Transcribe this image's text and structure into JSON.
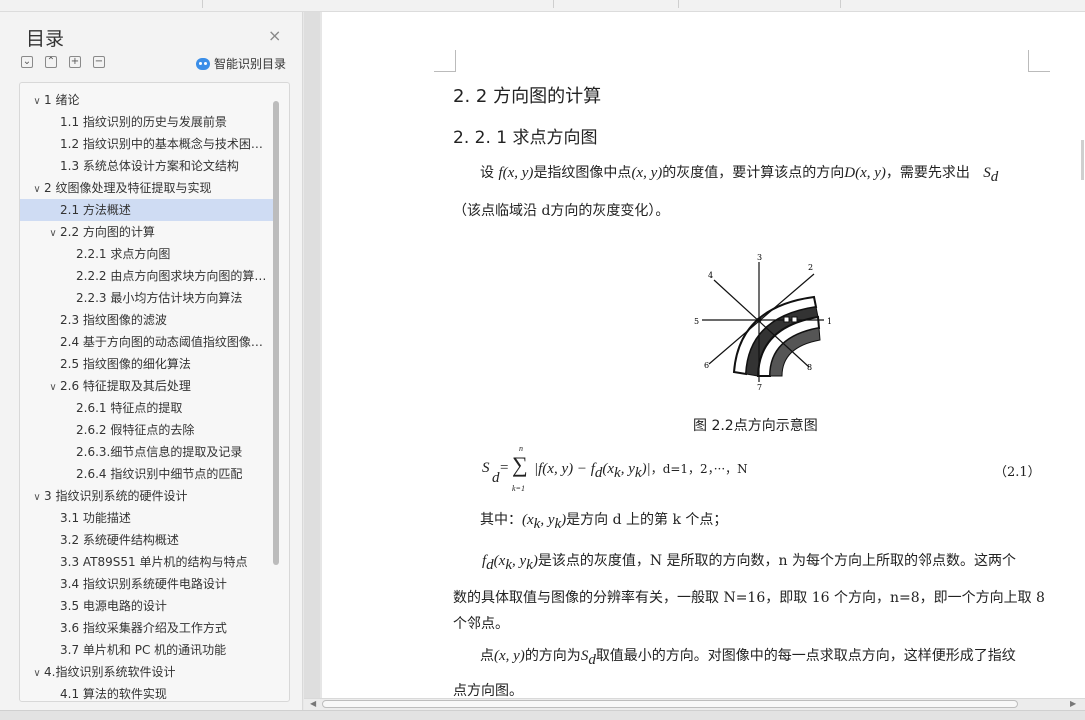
{
  "sidebar": {
    "title": "目录",
    "close_glyph": "×",
    "tools": [
      "⌄",
      "⌃",
      "+",
      "−"
    ],
    "ai_label": "智能识别目录",
    "toc": [
      {
        "level": 0,
        "arrow": "∨",
        "label": "1   绪论"
      },
      {
        "level": 1,
        "arrow": "",
        "label": "1.1 指纹识别的历史与发展前景"
      },
      {
        "level": 1,
        "arrow": "",
        "label": "1.2 指纹识别中的基本概念与技术困…"
      },
      {
        "level": 1,
        "arrow": "",
        "label": "1.3 系统总体设计方案和论文结构"
      },
      {
        "level": 0,
        "arrow": "∨",
        "label": "2   纹图像处理及特征提取与实现"
      },
      {
        "level": 1,
        "arrow": "",
        "label": "2.1  方法概述",
        "selected": true
      },
      {
        "level": 1,
        "arrow": "∨",
        "label": "2.2 方向图的计算"
      },
      {
        "level": 2,
        "arrow": "",
        "label": "2.2.1 求点方向图"
      },
      {
        "level": 2,
        "arrow": "",
        "label": "2.2.2 由点方向图求块方向图的算…"
      },
      {
        "level": 2,
        "arrow": "",
        "label": "2.2.3 最小均方估计块方向算法"
      },
      {
        "level": 1,
        "arrow": "",
        "label": "2.3 指纹图像的滤波"
      },
      {
        "level": 1,
        "arrow": "",
        "label": "2.4 基于方向图的动态阈值指纹图像…"
      },
      {
        "level": 1,
        "arrow": "",
        "label": "2.5 指纹图像的细化算法"
      },
      {
        "level": 1,
        "arrow": "∨",
        "label": "2.6 特征提取及其后处理"
      },
      {
        "level": 2,
        "arrow": "",
        "label": "2.6.1 特征点的提取"
      },
      {
        "level": 2,
        "arrow": "",
        "label": "2.6.2 假特征点的去除"
      },
      {
        "level": 2,
        "arrow": "",
        "label": "2.6.3.细节点信息的提取及记录"
      },
      {
        "level": 2,
        "arrow": "",
        "label": "2.6.4 指纹识别中细节点的匹配"
      },
      {
        "level": 0,
        "arrow": "∨",
        "label": "3  指纹识别系统的硬件设计"
      },
      {
        "level": 1,
        "arrow": "",
        "label": "3.1 功能描述"
      },
      {
        "level": 1,
        "arrow": "",
        "label": "3.2 系统硬件结构概述"
      },
      {
        "level": 1,
        "arrow": "",
        "label": "3.3    AT89S51 单片机的结构与特点"
      },
      {
        "level": 1,
        "arrow": "",
        "label": "3.4 指纹识别系统硬件电路设计"
      },
      {
        "level": 1,
        "arrow": "",
        "label": "3.5 电源电路的设计"
      },
      {
        "level": 1,
        "arrow": "",
        "label": "3.6 指纹采集器介绍及工作方式"
      },
      {
        "level": 1,
        "arrow": "",
        "label": "3.7 单片机和 PC 机的通讯功能"
      },
      {
        "level": 0,
        "arrow": "∨",
        "label": "4.指纹识别系统软件设计"
      },
      {
        "level": 1,
        "arrow": "",
        "label": "4.1 算法的软件实现"
      }
    ]
  },
  "document": {
    "heading1": "2. 2 方向图的计算",
    "heading2": "2. 2. 1 求点方向图",
    "p1": {
      "t1": "设 ",
      "m1": "f(x, y)",
      "t2": "是指纹图像中点",
      "m2": "(x, y)",
      "t3": "的灰度值，要计算该点的方向",
      "m3": "D(x, y)",
      "t4": "，需要先求出",
      "m4": "S",
      "m4sub": "d"
    },
    "p1_line2": "（该点临域沿 d方向的灰度变化）。",
    "figure_labels": [
      "1",
      "2",
      "3",
      "4",
      "5",
      "6",
      "7",
      "8"
    ],
    "figure_caption": "图 2.2点方向示意图",
    "formula": {
      "lhs": "S",
      "lhs_sub": "d",
      "eq": "=",
      "sum_top": "n",
      "sum_sign": "∑",
      "sum_bottom": "k=1",
      "body": "|f(x, y) − f",
      "body_sub": "d",
      "body_tail": "(x",
      "xk_sub": "k",
      "comma_y": ", y",
      "yk_sub": "k",
      "close": ")|",
      "range": "，d=1，2，···，N",
      "number": "（2.1）"
    },
    "p2": {
      "t1": "其中：",
      "m": "(x",
      "ms1": "k",
      "m2": ", y",
      "ms2": "k",
      "m3": ")",
      "t2": "是方向 d 上的第 k 个点；"
    },
    "p3": {
      "m": "f",
      "msub": "d",
      "m2": "(x",
      "ms1": "k",
      "m3": ", y",
      "ms2": "k",
      "m4": ")",
      "t1": "是该点的灰度值，N 是所取的方向数，n 为每个方向上所取的邻点数。这两个"
    },
    "p3_line2": "数的具体取值与图像的分辨率有关，一般取 N=16，即取 16 个方向，n=8，即一个方向上取 8",
    "p3_line3": "个邻点。",
    "p4": {
      "t1": "点",
      "m": "(x, y)",
      "t2": "的方向为",
      "m2": "S",
      "m2sub": "d",
      "t3": "取值最小的方向。对图像中的每一点求取点方向，这样便形成了指纹"
    },
    "p4_line2": "点方向图。"
  }
}
